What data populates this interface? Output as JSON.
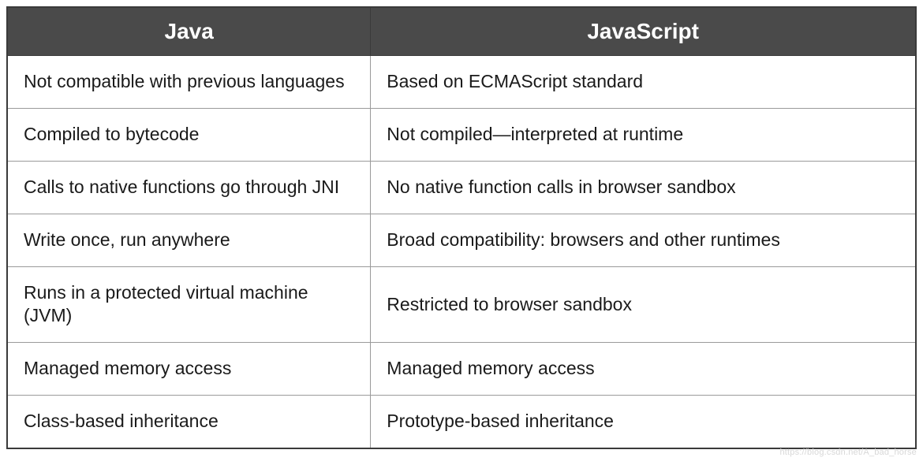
{
  "chart_data": {
    "type": "table",
    "title": "",
    "columns": [
      "Java",
      "JavaScript"
    ],
    "rows": [
      [
        "Not compatible with previous languages",
        "Based on ECMAScript standard"
      ],
      [
        "Compiled to bytecode",
        "Not compiled—interpreted at runtime"
      ],
      [
        "Calls to native functions go through JNI",
        "No native function calls in browser sandbox"
      ],
      [
        "Write once, run anywhere",
        "Broad compatibility: browsers and other runtimes"
      ],
      [
        "Runs in a protected virtual machine (JVM)",
        "Restricted to browser sandbox"
      ],
      [
        "Managed memory access",
        "Managed memory access"
      ],
      [
        "Class-based inheritance",
        "Prototype-based inheritance"
      ]
    ]
  },
  "watermark": "https://blog.csdn.net/A_bad_horse"
}
